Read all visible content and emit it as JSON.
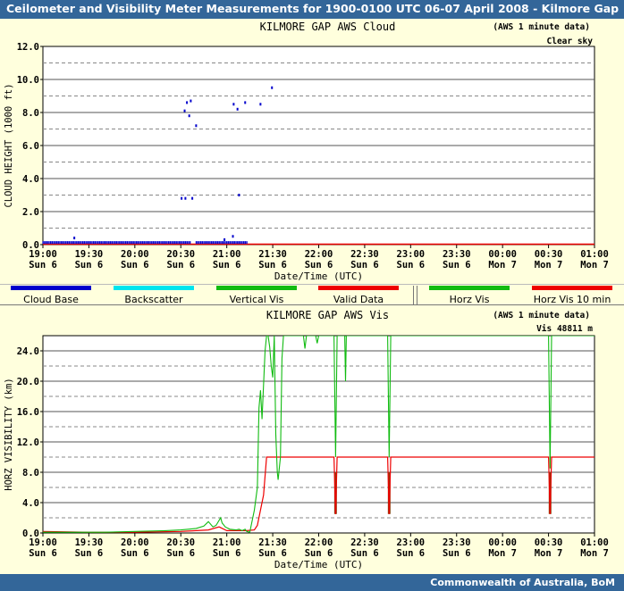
{
  "header": {
    "title": "Ceilometer and Visibility Meter Measurements for 1900-0100 UTC  06-07 April 2008 - Kilmore Gap"
  },
  "footer": {
    "credit": "Commonwealth of  Australia, BoM"
  },
  "legend": [
    {
      "label": "Cloud Base",
      "color": "#0000cc"
    },
    {
      "label": "Backscatter",
      "color": "#00e5ee"
    },
    {
      "label": "Vertical Vis",
      "color": "#11bb11"
    },
    {
      "label": "Valid Data",
      "color": "#ee0000"
    },
    {
      "label": "Horz Vis",
      "color": "#11bb11"
    },
    {
      "label": "Horz Vis 10 min",
      "color": "#ee0000"
    }
  ],
  "chart_data": [
    {
      "type": "scatter",
      "title": "KILMORE GAP AWS Cloud",
      "note": "(AWS 1 minute data)",
      "status": "Clear sky",
      "xlabel": "Date/Time (UTC)",
      "ylabel": "CLOUD HEIGHT (1000 ft)",
      "ylim": [
        0,
        12.0
      ],
      "yticks": [
        "0.0",
        "2.0",
        "4.0",
        "6.0",
        "8.0",
        "10.0",
        "12.0"
      ],
      "xlim": [
        0,
        360
      ],
      "xticks": [
        [
          "19:00",
          "Sun 6"
        ],
        [
          "19:30",
          "Sun 6"
        ],
        [
          "20:00",
          "Sun 6"
        ],
        [
          "20:30",
          "Sun 6"
        ],
        [
          "21:00",
          "Sun 6"
        ],
        [
          "21:30",
          "Sun 6"
        ],
        [
          "22:00",
          "Sun 6"
        ],
        [
          "22:30",
          "Sun 6"
        ],
        [
          "23:00",
          "Sun 6"
        ],
        [
          "23:30",
          "Sun 6"
        ],
        [
          "00:00",
          "Mon 7"
        ],
        [
          "00:30",
          "Mon 7"
        ],
        [
          "01:00",
          "Mon 7"
        ]
      ],
      "grid": true,
      "series": [
        {
          "name": "Cloud Base",
          "color": "#0000cc",
          "points": [
            [
              20.5,
              0.4
            ],
            [
              90.5,
              2.8
            ],
            [
              93,
              2.8
            ],
            [
              97.5,
              2.8
            ],
            [
              92.5,
              8.1
            ],
            [
              94,
              8.6
            ],
            [
              96.5,
              8.7
            ],
            [
              95.5,
              7.8
            ],
            [
              100,
              7.2
            ],
            [
              118.5,
              0.3
            ],
            [
              124,
              0.5
            ],
            [
              124.5,
              8.5
            ],
            [
              127,
              8.2
            ],
            [
              128,
              3.0
            ],
            [
              132,
              8.6
            ],
            [
              142,
              8.5
            ],
            [
              149.5,
              9.5
            ]
          ],
          "baseline_ranges": [
            [
              0,
              96
            ],
            [
              100,
              133
            ]
          ],
          "baseline_value": 0.1
        },
        {
          "name": "Valid Data",
          "color": "#ee0000",
          "baseline_value": 0,
          "range": [
            0,
            360
          ]
        }
      ]
    },
    {
      "type": "line",
      "title": "KILMORE GAP AWS Vis",
      "note": "(AWS 1 minute data)",
      "status": "Vis 48811 m",
      "xlabel": "Date/Time (UTC)",
      "ylabel": "HORZ VISIBILITY (km)",
      "ylim": [
        0,
        26.0
      ],
      "yticks": [
        "0.0",
        "4.0",
        "8.0",
        "12.0",
        "16.0",
        "20.0",
        "24.0"
      ],
      "xlim": [
        0,
        360
      ],
      "xticks": [
        [
          "19:00",
          "Sun 6"
        ],
        [
          "19:30",
          "Sun 6"
        ],
        [
          "20:00",
          "Sun 6"
        ],
        [
          "20:30",
          "Sun 6"
        ],
        [
          "21:00",
          "Sun 6"
        ],
        [
          "21:30",
          "Sun 6"
        ],
        [
          "22:00",
          "Sun 6"
        ],
        [
          "22:30",
          "Sun 6"
        ],
        [
          "23:00",
          "Sun 6"
        ],
        [
          "23:30",
          "Sun 6"
        ],
        [
          "00:00",
          "Mon 7"
        ],
        [
          "00:30",
          "Mon 7"
        ],
        [
          "01:00",
          "Mon 7"
        ]
      ],
      "grid": true,
      "series": [
        {
          "name": "Horz Vis",
          "color": "#11bb11",
          "points": [
            [
              0,
              0.1
            ],
            [
              40,
              0.1
            ],
            [
              60,
              0.2
            ],
            [
              80,
              0.3
            ],
            [
              90,
              0.4
            ],
            [
              95,
              0.5
            ],
            [
              100,
              0.6
            ],
            [
              105,
              0.9
            ],
            [
              108,
              1.5
            ],
            [
              111,
              0.8
            ],
            [
              113,
              1.0
            ],
            [
              116,
              2.0
            ],
            [
              117,
              1.3
            ],
            [
              119,
              0.8
            ],
            [
              122,
              0.5
            ],
            [
              126,
              0.4
            ],
            [
              128,
              0.5
            ],
            [
              130,
              0.3
            ],
            [
              132,
              0.5
            ],
            [
              133,
              0.2
            ],
            [
              135,
              0.1
            ],
            [
              138,
              3.0
            ],
            [
              140,
              6.0
            ],
            [
              141,
              16.5
            ],
            [
              142,
              18.8
            ],
            [
              143,
              15.0
            ],
            [
              144,
              19.5
            ],
            [
              145,
              24.0
            ],
            [
              146,
              26.0
            ],
            [
              147,
              26.0
            ],
            [
              148,
              24.5
            ],
            [
              149,
              22.0
            ],
            [
              150,
              20.5
            ],
            [
              151,
              26.0
            ],
            [
              152,
              13.0
            ],
            [
              153,
              8.0
            ],
            [
              153.5,
              7.0
            ],
            [
              155,
              10.0
            ],
            [
              156,
              23.0
            ],
            [
              157,
              26.0
            ],
            [
              170,
              26.0
            ],
            [
              171,
              24.3
            ],
            [
              172,
              26.0
            ],
            [
              178,
              26.0
            ],
            [
              179,
              25.0
            ],
            [
              180,
              26.0
            ],
            [
              190,
              26.0
            ],
            [
              191,
              10.0
            ],
            [
              192,
              26.0
            ],
            [
              197,
              26.0
            ],
            [
              197.5,
              20.0
            ],
            [
              198,
              26.0
            ],
            [
              225,
              26.0
            ],
            [
              226,
              10.0
            ],
            [
              227,
              26.0
            ],
            [
              330,
              26.0
            ],
            [
              331,
              8.5
            ],
            [
              332,
              26.0
            ],
            [
              360,
              26.0
            ]
          ]
        },
        {
          "name": "Horz Vis 10 min",
          "color": "#ee0000",
          "points": [
            [
              0,
              0.2
            ],
            [
              30,
              0.1
            ],
            [
              60,
              0.1
            ],
            [
              90,
              0.2
            ],
            [
              100,
              0.3
            ],
            [
              108,
              0.4
            ],
            [
              115,
              0.8
            ],
            [
              120,
              0.3
            ],
            [
              133,
              0.3
            ],
            [
              138,
              0.4
            ],
            [
              140,
              1.0
            ],
            [
              144,
              5.0
            ],
            [
              146,
              10.0
            ],
            [
              190,
              10.0
            ],
            [
              191,
              2.5
            ],
            [
              192,
              10.0
            ],
            [
              225,
              10.0
            ],
            [
              226,
              2.5
            ],
            [
              227,
              10.0
            ],
            [
              330,
              10.0
            ],
            [
              331,
              2.5
            ],
            [
              332,
              10.0
            ],
            [
              360,
              10.0
            ]
          ],
          "drops": [
            191,
            226,
            331
          ]
        }
      ]
    }
  ]
}
